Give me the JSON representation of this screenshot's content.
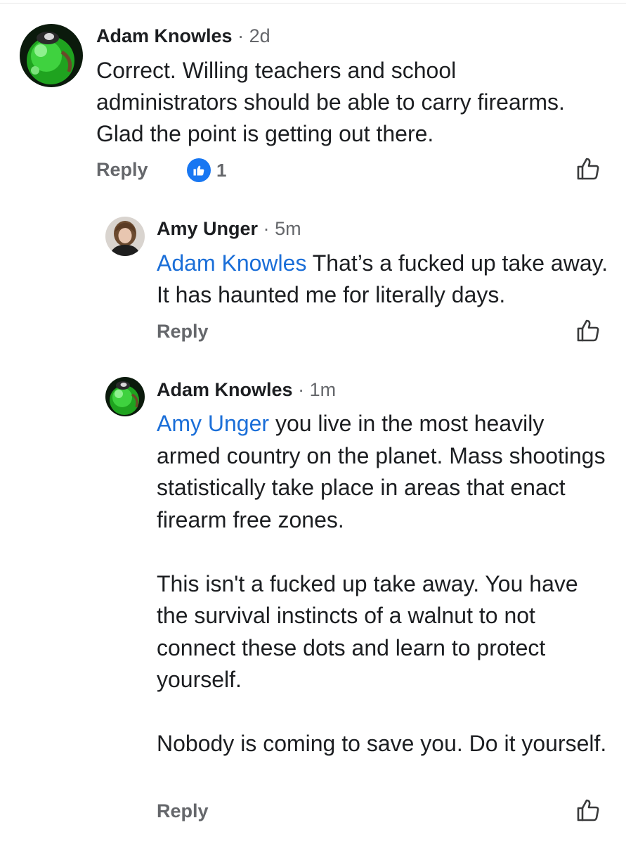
{
  "colors": {
    "author_text": "#1c1e21",
    "meta_text": "#65676b",
    "mention": "#1a6ed8",
    "reaction_blue": "#1877f2"
  },
  "comments": [
    {
      "author": "Adam Knowles",
      "separator": "·",
      "time": "2d",
      "avatar_icon": "green-orb-avatar",
      "text_paragraphs": [
        "Correct. Willing teachers and school administrators should be able to carry firearms. Glad the point is getting out there."
      ],
      "reply_label": "Reply",
      "reaction": {
        "icon": "thumbs-up-reaction-icon",
        "count": "1"
      },
      "like_icon": "thumbs-up-outline-icon"
    },
    {
      "author": "Amy Unger",
      "separator": "·",
      "time": "5m",
      "avatar_icon": "person-photo-avatar",
      "mention": "Adam Knowles",
      "text_paragraphs": [
        "That’s a fucked up take away. It has haunted me for literally days."
      ],
      "reply_label": "Reply",
      "like_icon": "thumbs-up-outline-icon"
    },
    {
      "author": "Adam Knowles",
      "separator": "·",
      "time": "1m",
      "avatar_icon": "green-orb-avatar",
      "mention": "Amy Unger",
      "text_paragraphs": [
        "you live in the most heavily armed country on the planet. Mass shootings statistically take place in areas that enact firearm free zones.",
        "This isn't a fucked up take away. You have the survival instincts of a walnut to not connect these dots and learn to protect yourself.",
        "Nobody is coming to save you. Do it yourself."
      ],
      "reply_label": "Reply",
      "like_icon": "thumbs-up-outline-icon"
    }
  ]
}
